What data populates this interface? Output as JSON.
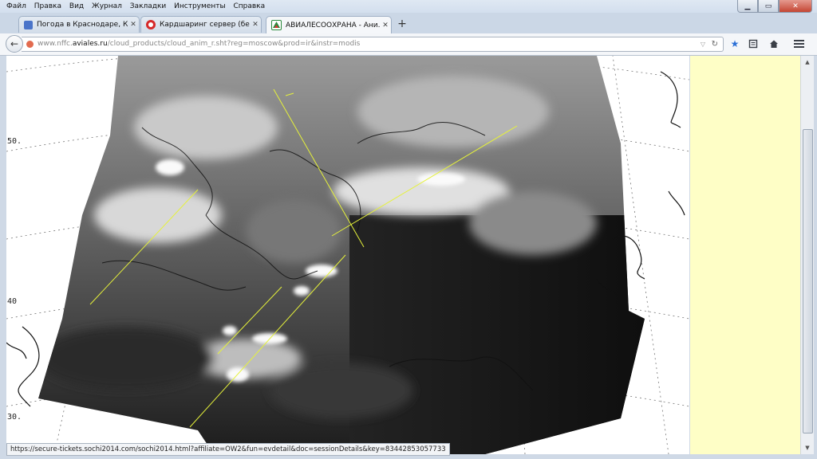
{
  "menu": [
    "Файл",
    "Правка",
    "Вид",
    "Журнал",
    "Закладки",
    "Инструменты",
    "Справка"
  ],
  "window_buttons": {
    "minimize": "▁",
    "maximize": "▭",
    "close": "✕"
  },
  "tabs": [
    {
      "label": "Погода в Краснодаре, Крас...",
      "active": false,
      "icon": "weather-favicon",
      "color": "#4a74c9"
    },
    {
      "label": "Кардшаринг сервер (бесп...",
      "active": false,
      "icon": "red-circle-favicon",
      "color": "#d62a2a"
    },
    {
      "label": "АВИАЛЕСООХРАНА - Ани...",
      "active": true,
      "icon": "avialesookhrana-favicon",
      "color": "#2b8a3e"
    }
  ],
  "new_tab_label": "+",
  "url": {
    "prefix": "www.nffc.",
    "domain": "aviales.ru",
    "path": "/cloud_products/cloud_anim_r.sht?reg=moscow&prod=ir&instr=modis"
  },
  "map": {
    "lat_labels": [
      "50.",
      "40",
      "30."
    ]
  },
  "status_link": "https://secure-tickets.sochi2014.com/sochi2014.html?affiliate=OW2&fun=evdetail&doc=sessionDetails&key=83442853057733",
  "colors": {
    "sidebar": "#fefec6",
    "overlay_line": "#e6f23a"
  }
}
